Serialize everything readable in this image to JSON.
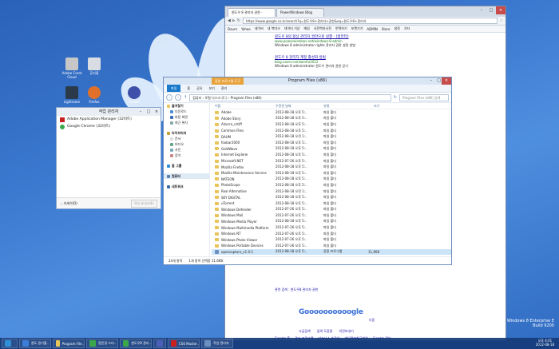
{
  "desktop": {
    "icons": [
      {
        "label": "Adobe Creat Cloud",
        "color": "#c7c7c7"
      },
      {
        "label": "휴지통",
        "color": "#d9dde3"
      },
      {
        "label": "FileZilla",
        "color": "#b11d1d"
      },
      {
        "label": "Mozilla Firefox",
        "color": "#e0702a"
      },
      {
        "label": "Lightroom",
        "color": "#2b3a4a"
      },
      {
        "label": "Firefox",
        "color": "#d8652b"
      },
      {
        "label": "Viewer",
        "color": "#3d4fa8"
      }
    ],
    "watermark_line1": "Windows 8 Enterprise E",
    "watermark_line2": "Build 9200"
  },
  "task_manager": {
    "title": "작업 관리자",
    "apps": [
      {
        "label": "Adobe Application Manager (32비트)",
        "icon": "adobe-icon",
        "color": "#c82020"
      },
      {
        "label": "Google Chrome (32비트)",
        "icon": "chrome-icon",
        "color": "#3aa84a"
      }
    ],
    "details_label": "자세히(D)",
    "end_task_label": "작업 끝내기(E)"
  },
  "chrome": {
    "tabs": [
      "윈도우 8 관리자 권한 -",
      "PowerWindows Blog"
    ],
    "url": "https://www.google.co.kr/search?q=윈도우8+관리자+권한&oq=윈도우8+관리자",
    "bookmarks": [
      "Daum",
      "Yahoo",
      "네이버",
      "내 북마크",
      "데이터 기상",
      "메일",
      "사전백과사전",
      "번역하기",
      "포켓기가",
      "ADMIN",
      "Store",
      "설정",
      "기타"
    ],
    "results": [
      {
        "title": "윈도우 8의 항상 관리자 권한으로 실행 - [컴퓨터]",
        "url": "www.powerwindows.net/windows-8-admin",
        "text": "Windows 8 administrator rights 관리자 권한 설정 방법"
      },
      {
        "title": "윈도우 8 관리자 계정 활성화 방법",
        "url": "blog.naver.com/winfo/2012",
        "text": "Windows 8 administrator 윈도우 관리자 권한 얻기"
      }
    ],
    "footer": {
      "related": "관련 검색 : 윈도우8 관리자 권한",
      "logo": "Goooooooooogle",
      "pages": [
        "1",
        "2",
        "3",
        "4",
        "5",
        "6",
        "7",
        "8",
        "9",
        "10"
      ],
      "next": "다음",
      "links": [
        "고급검색",
        "검색 도움말",
        "의견보내기"
      ],
      "bottom": [
        "Google 홈",
        "광고 프로그램",
        "비즈니스 솔루션",
        "개인정보취급방침",
        "Google 정보"
      ]
    }
  },
  "explorer": {
    "title": "Program Files (x86)",
    "context_tab": "응용 프로그램 도구",
    "ribbon": [
      "파일",
      "홈",
      "공유",
      "보기",
      "관리"
    ],
    "address": "컴퓨터 › 로컬 디스크 (C:) › Program Files (x86)",
    "search_placeholder": "Program Files (x86) 검색",
    "sidebar": {
      "favorites_head": "즐겨찾기",
      "favorites": [
        "다운로드",
        "바탕 화면",
        "최근 위치"
      ],
      "libraries_head": "라이브러리",
      "libraries": [
        "문서",
        "비디오",
        "사진",
        "음악"
      ],
      "homegroup": "홈 그룹",
      "computer": "컴퓨터",
      "network": "네트워크"
    },
    "columns": [
      "이름",
      "수정한 날짜",
      "유형",
      "크기"
    ],
    "files": [
      {
        "name": "Adobe",
        "date": "2012-08-18 오후 5:..",
        "type": "파일 폴더",
        "size": "",
        "kind": "folder"
      },
      {
        "name": "Adobe Story",
        "date": "2012-08-18 오후 5:..",
        "type": "파일 폴더",
        "size": "",
        "kind": "folder"
      },
      {
        "name": "Alzurra_cstiff",
        "date": "2012-08-18 오후 5:..",
        "type": "파일 폴더",
        "size": "",
        "kind": "folder"
      },
      {
        "name": "Common Files",
        "date": "2012-08-18 오후 5:..",
        "type": "파일 폴더",
        "size": "",
        "kind": "folder"
      },
      {
        "name": "DAUM",
        "date": "2012-08-18 오전 1:..",
        "type": "파일 폴더",
        "size": "",
        "kind": "folder"
      },
      {
        "name": "foobar2000",
        "date": "2012-08-18 오후 5:..",
        "type": "파일 폴더",
        "size": "",
        "kind": "folder"
      },
      {
        "name": "GoldWave",
        "date": "2012-08-18 오후 5:..",
        "type": "파일 폴더",
        "size": "",
        "kind": "folder"
      },
      {
        "name": "Internet Explorer",
        "date": "2012-08-18 오후 5:..",
        "type": "파일 폴더",
        "size": "",
        "kind": "folder"
      },
      {
        "name": "Microsoft.NET",
        "date": "2012-07-26 오후 5:..",
        "type": "파일 폴더",
        "size": "",
        "kind": "folder"
      },
      {
        "name": "Mozilla Firefox",
        "date": "2012-08-18 오후 5:..",
        "type": "파일 폴더",
        "size": "",
        "kind": "folder"
      },
      {
        "name": "Mozilla Maintenance Service",
        "date": "2012-08-18 오후 5:..",
        "type": "파일 폴더",
        "size": "",
        "kind": "folder"
      },
      {
        "name": "NATEON",
        "date": "2012-08-18 오후 5:..",
        "type": "파일 폴더",
        "size": "",
        "kind": "folder"
      },
      {
        "name": "PhotoScape",
        "date": "2012-08-18 오후 5:..",
        "type": "파일 폴더",
        "size": "",
        "kind": "folder"
      },
      {
        "name": "Real Alternative",
        "date": "2012-08-18 오전 1:..",
        "type": "파일 폴더",
        "size": "",
        "kind": "folder"
      },
      {
        "name": "SKY DIGITAL",
        "date": "2012-08-18 오후 5:..",
        "type": "파일 폴더",
        "size": "",
        "kind": "folder"
      },
      {
        "name": "uTorrent",
        "date": "2012-08-18 오후 5:..",
        "type": "파일 폴더",
        "size": "",
        "kind": "folder"
      },
      {
        "name": "Windows Defender",
        "date": "2012-07-26 오후 5:..",
        "type": "파일 폴더",
        "size": "",
        "kind": "folder"
      },
      {
        "name": "Windows Mail",
        "date": "2012-07-26 오후 5:..",
        "type": "파일 폴더",
        "size": "",
        "kind": "folder"
      },
      {
        "name": "Windows Media Player",
        "date": "2012-08-18 오후 5:..",
        "type": "파일 폴더",
        "size": "",
        "kind": "folder"
      },
      {
        "name": "Windows Multimedia Platform",
        "date": "2012-07-26 오후 5:..",
        "type": "파일 폴더",
        "size": "",
        "kind": "folder"
      },
      {
        "name": "Windows NT",
        "date": "2012-07-26 오후 5:..",
        "type": "파일 폴더",
        "size": "",
        "kind": "folder"
      },
      {
        "name": "Windows Photo Viewer",
        "date": "2012-07-26 오후 5:..",
        "type": "파일 폴더",
        "size": "",
        "kind": "folder"
      },
      {
        "name": "Windows Portable Devices",
        "date": "2012-07-26 오후 5:..",
        "type": "파일 폴더",
        "size": "",
        "kind": "folder"
      },
      {
        "name": "opencapture_v1.0.5",
        "date": "2012-08-18 오후 5:..",
        "type": "응용 프로그램",
        "size": "11,908",
        "kind": "exe"
      }
    ],
    "status_count": "24개 항목",
    "status_selected": "1개 항목 선택함 11.6KB"
  },
  "taskbar": {
    "buttons": [
      {
        "label": "",
        "icon": "ie-icon",
        "color": "#2f8fd8"
      },
      {
        "label": "윈도 용기할..",
        "icon": "folder-icon",
        "color": "#3b7dd8"
      },
      {
        "label": "Program File..",
        "icon": "explorer-icon",
        "color": "#e8c45a"
      },
      {
        "label": "정윤경 스티..",
        "icon": "chrome-icon",
        "color": "#3aa84a"
      },
      {
        "label": "윈도우8 관리..",
        "icon": "chrome-icon",
        "color": "#3aa84a"
      },
      {
        "label": "",
        "icon": "word-icon",
        "color": "#4a5fb8"
      },
      {
        "label": "CS6 Master..",
        "icon": "adobe-icon",
        "color": "#c82020"
      },
      {
        "label": "작업 관리자",
        "icon": "taskmgr-icon",
        "color": "#6b8fbf"
      }
    ],
    "time": "오후 4:41",
    "date": "2012-08-18"
  }
}
